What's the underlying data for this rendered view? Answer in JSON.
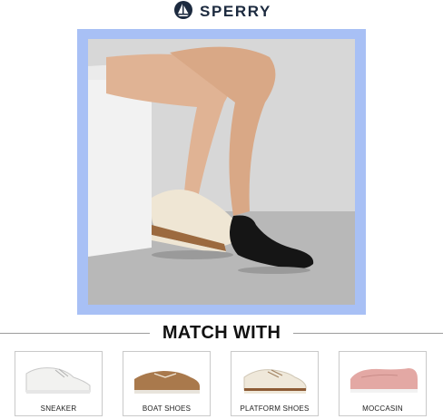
{
  "brand": {
    "name": "SPERRY",
    "logo_icon": "sailboat-logo-icon"
  },
  "section_title": "MATCH WITH",
  "products": [
    {
      "label": "SNEAKER",
      "color": "#f2f2f0"
    },
    {
      "label": "BOAT SHOES",
      "color": "#a9794c"
    },
    {
      "label": "PLATFORM SHOES",
      "color": "#efe8da"
    },
    {
      "label": "MOCCASIN",
      "color": "#e3a8a4"
    }
  ],
  "colors": {
    "frame_accent": "#a8c0f5",
    "brand_text": "#1c2a3f"
  }
}
